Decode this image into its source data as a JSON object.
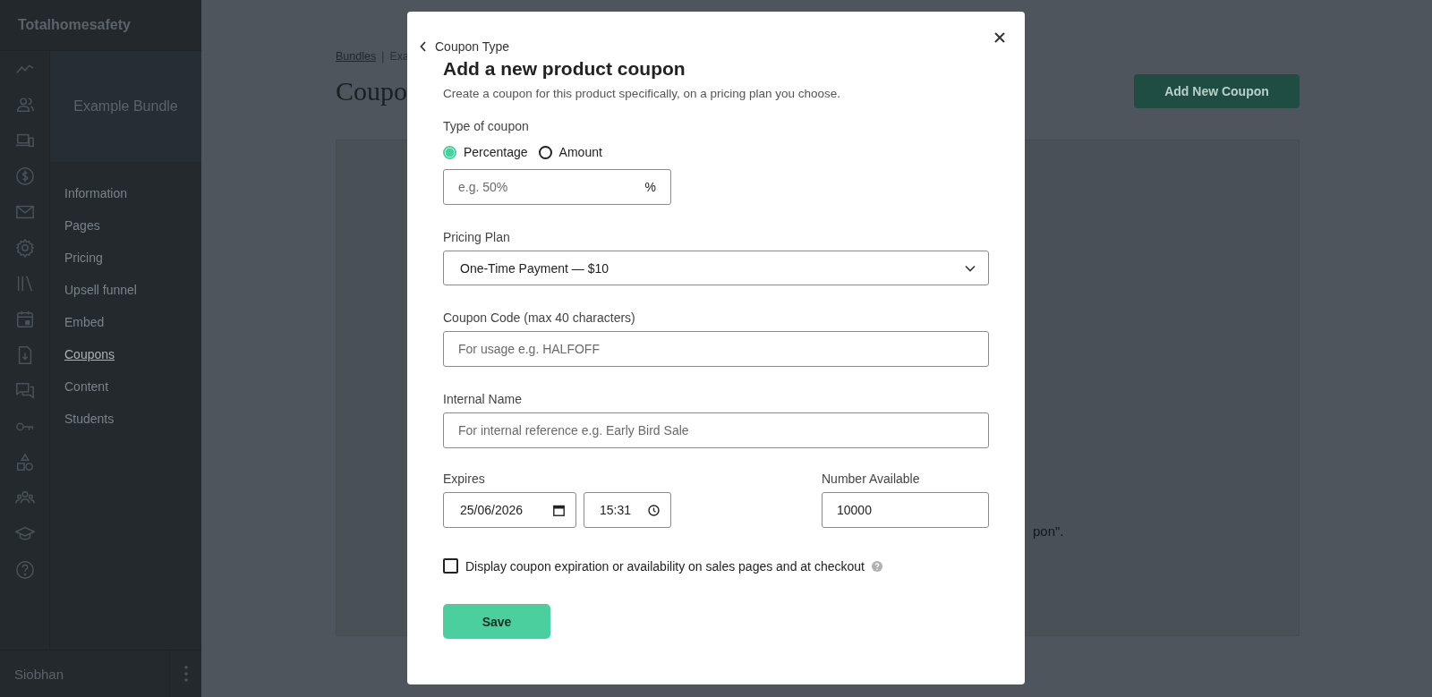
{
  "app": {
    "brand": "Totalhomesafety",
    "product": "Example Bundle",
    "nav": [
      {
        "label": "Information",
        "selected": false
      },
      {
        "label": "Pages",
        "selected": false
      },
      {
        "label": "Pricing",
        "selected": false
      },
      {
        "label": "Upsell funnel",
        "selected": false
      },
      {
        "label": "Embed",
        "selected": false
      },
      {
        "label": "Coupons",
        "selected": true
      },
      {
        "label": "Content",
        "selected": false
      },
      {
        "label": "Students",
        "selected": false
      }
    ],
    "user": "Siobhan"
  },
  "page": {
    "breadcrumb": [
      "Bundles",
      "|",
      "Exa"
    ],
    "title": "Coupo",
    "add_button": "Add New Coupon",
    "empty_text": "pon\"."
  },
  "modal": {
    "back": "Coupon Type",
    "title": "Add a new product coupon",
    "subtitle": "Create a coupon for this product specifically, on a pricing plan you choose.",
    "type_label": "Type of coupon",
    "types": [
      {
        "label": "Percentage",
        "selected": true
      },
      {
        "label": "Amount",
        "selected": false
      }
    ],
    "amount": {
      "placeholder": "e.g. 50%",
      "suffix": "%"
    },
    "plan_label": "Pricing Plan",
    "plan_value": "One-Time Payment — $10",
    "code_label": "Coupon Code (max 40 characters)",
    "code": {
      "placeholder": "For usage e.g. HALFOFF"
    },
    "name_label": "Internal Name",
    "name": {
      "placeholder": "For internal reference e.g. Early Bird Sale"
    },
    "expires_label": "Expires",
    "date": "25/06/2026",
    "time": "15:31",
    "number_label": "Number Available",
    "number": "10000",
    "display_checkbox": {
      "label": "Display coupon expiration or availability on sales pages and at checkout",
      "checked": false
    },
    "save": "Save"
  }
}
